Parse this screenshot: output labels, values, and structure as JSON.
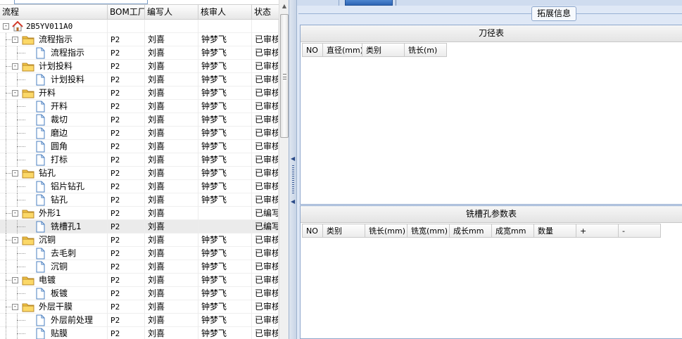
{
  "tree_grid": {
    "columns": {
      "name": "流程",
      "bom_factory": "BOM工厂",
      "author": "编写人",
      "reviewer": "核审人",
      "status": "状态"
    },
    "rows": [
      {
        "level": 0,
        "type": "root",
        "name": "2B5YV011A0",
        "bom": "",
        "author": "",
        "reviewer": "",
        "status": "",
        "expander": "-"
      },
      {
        "level": 1,
        "type": "folder",
        "name": "流程指示",
        "bom": "P2",
        "author": "刘喜",
        "reviewer": "钟梦飞",
        "status": "已审核",
        "expander": "-"
      },
      {
        "level": 2,
        "type": "doc",
        "name": "流程指示",
        "bom": "P2",
        "author": "刘喜",
        "reviewer": "钟梦飞",
        "status": "已审核"
      },
      {
        "level": 1,
        "type": "folder",
        "name": "计划投料",
        "bom": "P2",
        "author": "刘喜",
        "reviewer": "钟梦飞",
        "status": "已审核",
        "expander": "-"
      },
      {
        "level": 2,
        "type": "doc",
        "name": "计划投料",
        "bom": "P2",
        "author": "刘喜",
        "reviewer": "钟梦飞",
        "status": "已审核"
      },
      {
        "level": 1,
        "type": "folder",
        "name": "开料",
        "bom": "P2",
        "author": "刘喜",
        "reviewer": "钟梦飞",
        "status": "已审核",
        "expander": "-"
      },
      {
        "level": 2,
        "type": "doc",
        "name": "开料",
        "bom": "P2",
        "author": "刘喜",
        "reviewer": "钟梦飞",
        "status": "已审核"
      },
      {
        "level": 2,
        "type": "doc",
        "name": "裁切",
        "bom": "P2",
        "author": "刘喜",
        "reviewer": "钟梦飞",
        "status": "已审核"
      },
      {
        "level": 2,
        "type": "doc",
        "name": "磨边",
        "bom": "P2",
        "author": "刘喜",
        "reviewer": "钟梦飞",
        "status": "已审核"
      },
      {
        "level": 2,
        "type": "doc",
        "name": "圆角",
        "bom": "P2",
        "author": "刘喜",
        "reviewer": "钟梦飞",
        "status": "已审核"
      },
      {
        "level": 2,
        "type": "doc",
        "name": "打标",
        "bom": "P2",
        "author": "刘喜",
        "reviewer": "钟梦飞",
        "status": "已审核"
      },
      {
        "level": 1,
        "type": "folder",
        "name": "钻孔",
        "bom": "P2",
        "author": "刘喜",
        "reviewer": "钟梦飞",
        "status": "已审核",
        "expander": "-"
      },
      {
        "level": 2,
        "type": "doc",
        "name": "铝片钻孔",
        "bom": "P2",
        "author": "刘喜",
        "reviewer": "钟梦飞",
        "status": "已审核"
      },
      {
        "level": 2,
        "type": "doc",
        "name": "钻孔",
        "bom": "P2",
        "author": "刘喜",
        "reviewer": "钟梦飞",
        "status": "已审核"
      },
      {
        "level": 1,
        "type": "folder",
        "name": "外形1",
        "bom": "P2",
        "author": "刘喜",
        "reviewer": "",
        "status": "已编写",
        "expander": "-"
      },
      {
        "level": 2,
        "type": "doc",
        "name": "铣槽孔1",
        "bom": "P2",
        "author": "刘喜",
        "reviewer": "",
        "status": "已编写",
        "selected": true
      },
      {
        "level": 1,
        "type": "folder",
        "name": "沉铜",
        "bom": "P2",
        "author": "刘喜",
        "reviewer": "钟梦飞",
        "status": "已审核",
        "expander": "-"
      },
      {
        "level": 2,
        "type": "doc",
        "name": "去毛刺",
        "bom": "P2",
        "author": "刘喜",
        "reviewer": "钟梦飞",
        "status": "已审核"
      },
      {
        "level": 2,
        "type": "doc",
        "name": "沉铜",
        "bom": "P2",
        "author": "刘喜",
        "reviewer": "钟梦飞",
        "status": "已审核"
      },
      {
        "level": 1,
        "type": "folder",
        "name": "电镀",
        "bom": "P2",
        "author": "刘喜",
        "reviewer": "钟梦飞",
        "status": "已审核",
        "expander": "-"
      },
      {
        "level": 2,
        "type": "doc",
        "name": "板镀",
        "bom": "P2",
        "author": "刘喜",
        "reviewer": "钟梦飞",
        "status": "已审核"
      },
      {
        "level": 1,
        "type": "folder",
        "name": "外层干膜",
        "bom": "P2",
        "author": "刘喜",
        "reviewer": "钟梦飞",
        "status": "已审核",
        "expander": "-"
      },
      {
        "level": 2,
        "type": "doc",
        "name": "外层前处理",
        "bom": "P2",
        "author": "刘喜",
        "reviewer": "钟梦飞",
        "status": "已审核"
      },
      {
        "level": 2,
        "type": "doc",
        "name": "贴膜",
        "bom": "P2",
        "author": "刘喜",
        "reviewer": "钟梦飞",
        "status": "已审核"
      }
    ]
  },
  "extension": {
    "legend": "拓展信息",
    "cutter_table": {
      "title": "刀径表",
      "columns": [
        "NO",
        "直径(mm)",
        "类别",
        "铣长(m)"
      ]
    },
    "slot_table": {
      "title": "铣槽孔参数表",
      "columns": [
        "NO",
        "类别",
        "铣长(mm)",
        "铣宽(mm)",
        "成长mm",
        "成宽mm",
        "数量",
        "+",
        "-"
      ]
    }
  },
  "colors": {
    "tab_active": "#3a72c0",
    "panel_bg": "#dfe8f6",
    "folder_yellow": "#f4c542",
    "root_red": "#d23a2a"
  }
}
